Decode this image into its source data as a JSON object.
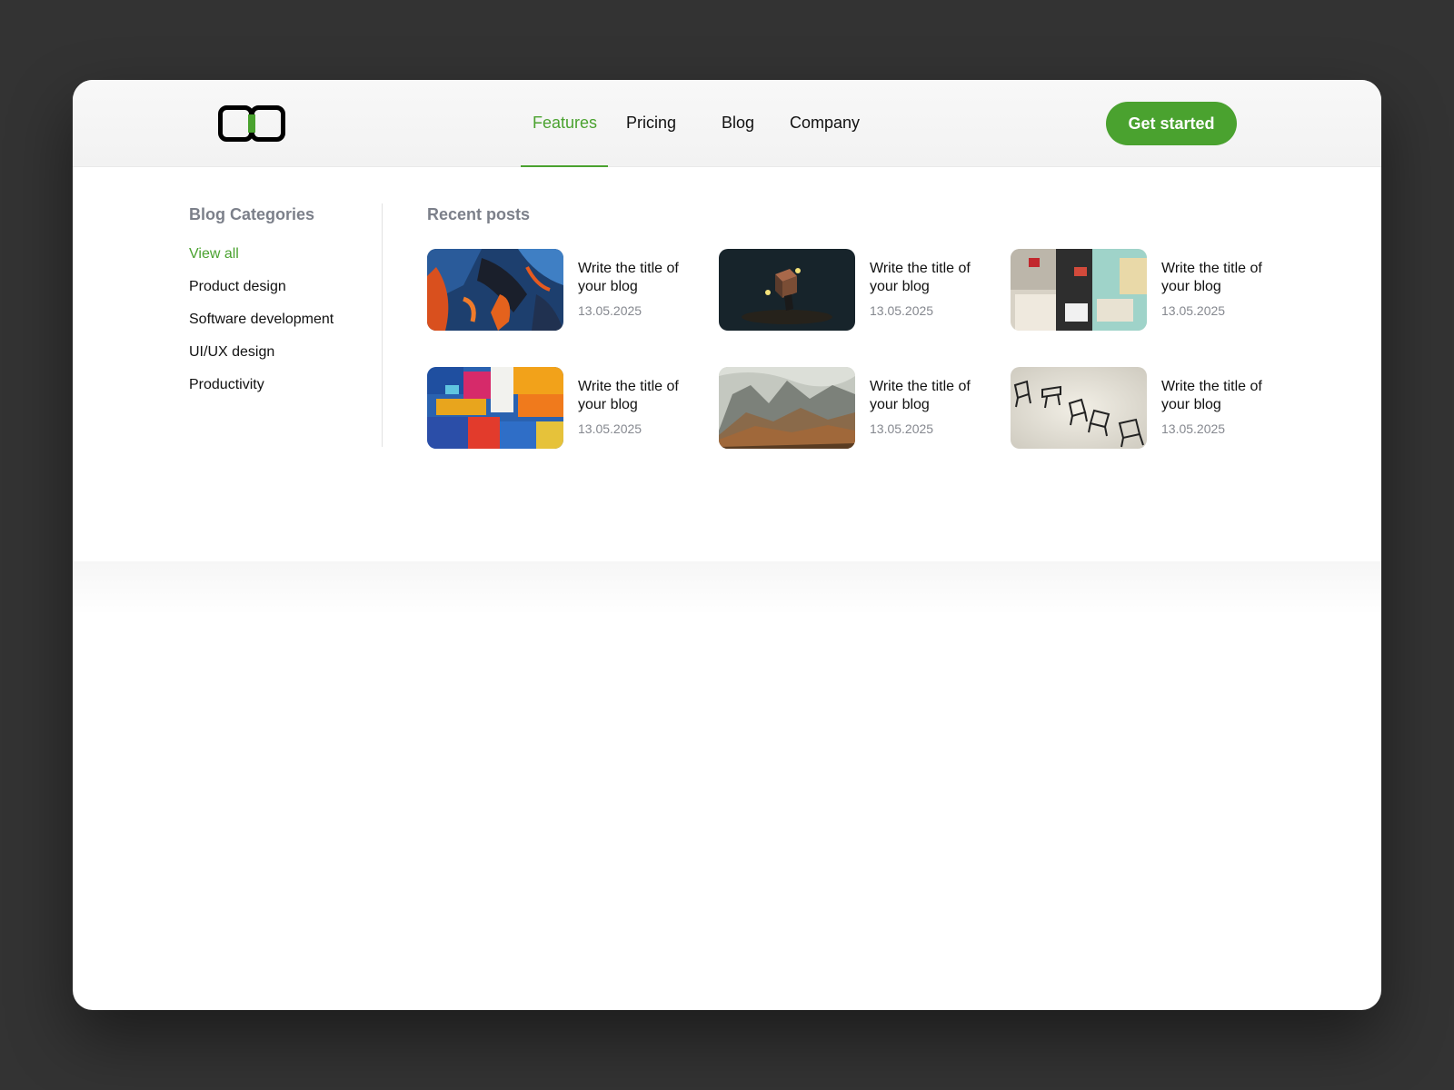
{
  "nav": {
    "links": [
      "Features",
      "Pricing",
      "Blog",
      "Company"
    ],
    "active_link": "Features",
    "cta_label": "Get started"
  },
  "colors": {
    "brand_green": "#4aa22f",
    "page_background": "#333333",
    "muted_heading": "#7c808a"
  },
  "categories": {
    "heading": "Blog Categories",
    "items": [
      "View all",
      "Product design",
      "Software development",
      "UI/UX design",
      "Productivity"
    ],
    "active_item": "View all"
  },
  "recent_posts": {
    "heading": "Recent posts",
    "posts": [
      {
        "title": "Write the title of your blog",
        "date": "13.05.2025",
        "thumbnail": "abstract-blue-orange-painting"
      },
      {
        "title": "Write the title of your blog",
        "date": "13.05.2025",
        "thumbnail": "dark-3d-cube-render"
      },
      {
        "title": "Write the title of your blog",
        "date": "13.05.2025",
        "thumbnail": "street-poster-collage"
      },
      {
        "title": "Write the title of your blog",
        "date": "13.05.2025",
        "thumbnail": "colorful-abstract-painting"
      },
      {
        "title": "Write the title of your blog",
        "date": "13.05.2025",
        "thumbnail": "mountain-landscape-painting"
      },
      {
        "title": "Write the title of your blog",
        "date": "13.05.2025",
        "thumbnail": "floating-chairs"
      }
    ]
  }
}
